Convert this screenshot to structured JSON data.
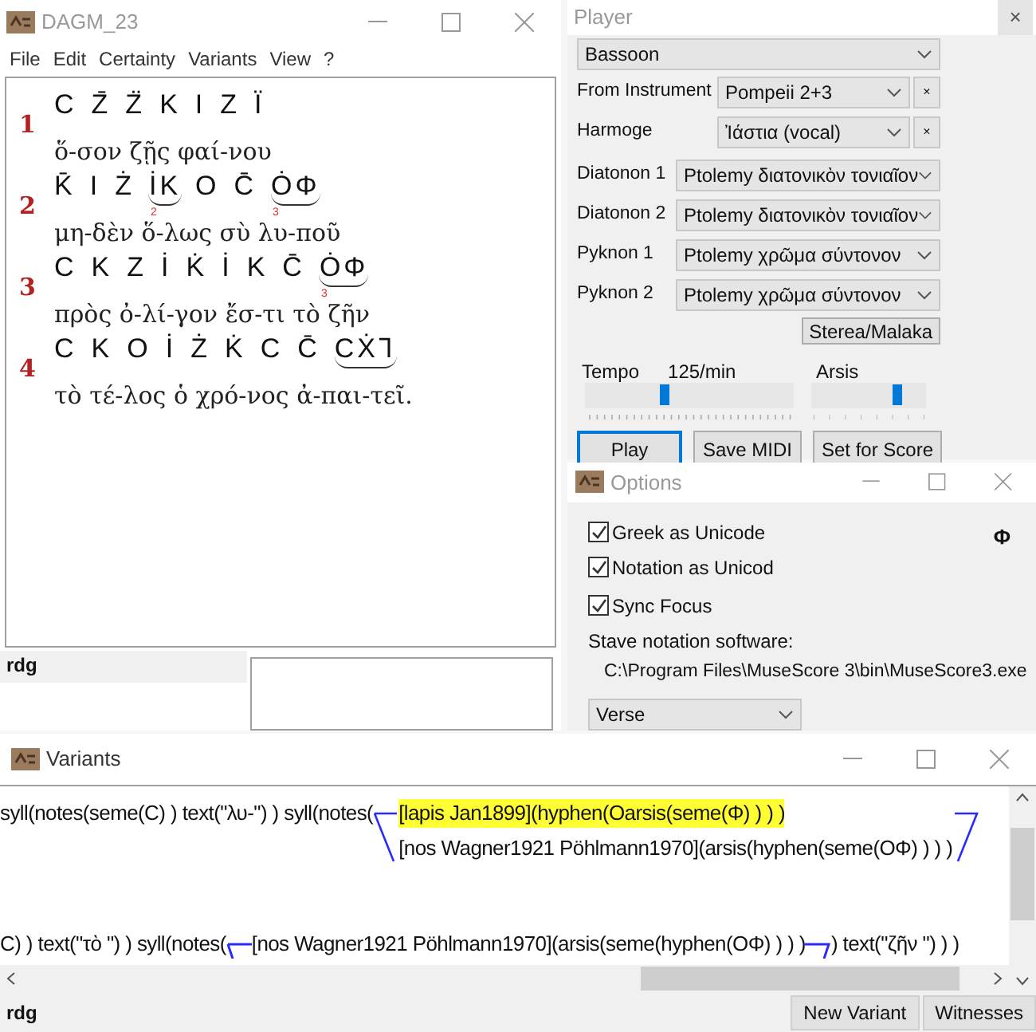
{
  "main_window": {
    "title": "DAGM_23",
    "menu": [
      "File",
      "Edit",
      "Certainty",
      "Variants",
      "View",
      "?"
    ],
    "lines": [
      {
        "number": "1",
        "notation": [
          {
            "text": "C",
            "slur": false
          },
          {
            "text": "Z̄",
            "slur": false
          },
          {
            "text": "Z̈",
            "slur": false
          },
          {
            "text": "K",
            "slur": false
          },
          {
            "text": "I",
            "slur": false
          },
          {
            "text": "Z",
            "slur": false
          },
          {
            "text": "Ï",
            "slur": false
          }
        ],
        "lyrics": "ὅ-σον ζῇς φαί-νου"
      },
      {
        "number": "2",
        "notation": [
          {
            "text": "K̄",
            "slur": false
          },
          {
            "text": "I",
            "slur": false
          },
          {
            "text": "Ż",
            "slur": false
          },
          {
            "text": "İK",
            "slur": true,
            "mark": "2"
          },
          {
            "text": "O",
            "slur": false
          },
          {
            "text": "C̄",
            "slur": false
          },
          {
            "text": "ȮΦ",
            "slur": true,
            "mark": "3"
          }
        ],
        "lyrics": "μη-δὲν ὅ-λως σὺ λυ-ποῦ"
      },
      {
        "number": "3",
        "notation": [
          {
            "text": "C",
            "slur": false
          },
          {
            "text": "K",
            "slur": false
          },
          {
            "text": "Z",
            "slur": false
          },
          {
            "text": "İ",
            "slur": false
          },
          {
            "text": "K̇",
            "slur": false
          },
          {
            "text": "İ",
            "slur": false
          },
          {
            "text": "K",
            "slur": false
          },
          {
            "text": "C̄",
            "slur": false
          },
          {
            "text": "ȮΦ",
            "slur": true,
            "mark": "3"
          }
        ],
        "lyrics": "πρὸς ὀ-λί-γον ἔσ-τι τὸ ζῆν"
      },
      {
        "number": "4",
        "notation": [
          {
            "text": "C",
            "slur": false
          },
          {
            "text": "K",
            "slur": false
          },
          {
            "text": "O",
            "slur": false
          },
          {
            "text": "İ",
            "slur": false
          },
          {
            "text": "Ż",
            "slur": false
          },
          {
            "text": "K̇",
            "slur": false
          },
          {
            "text": "C",
            "slur": false
          },
          {
            "text": "C̄",
            "slur": false
          },
          {
            "text": "CẊ⅂",
            "slur": true
          }
        ],
        "lyrics": "τὸ τέ-λος ὁ χρό-νος ἀ-παι-τεῖ."
      }
    ],
    "rdg_label": "rdg"
  },
  "player": {
    "title": "Player",
    "close": "×",
    "instrument": "Bassoon",
    "rows": [
      {
        "kind": "clearable",
        "label": "From Instrument",
        "value": "Pompeii 2+3",
        "clear": "×"
      },
      {
        "kind": "clearable",
        "label": "Harmoge",
        "value": "Ἰάστια (vocal)",
        "clear": "×"
      },
      {
        "kind": "plain",
        "label": "Diatonon 1",
        "value": "Ptolemy διατονικὸν τονιαῖον"
      },
      {
        "kind": "plain",
        "label": "Diatonon 2",
        "value": "Ptolemy διατονικὸν τονιαῖον"
      },
      {
        "kind": "plain",
        "label": "Pyknon 1",
        "value": "Ptolemy χρῶμα σύντονον"
      },
      {
        "kind": "plain",
        "label": "Pyknon 2",
        "value": "Ptolemy χρῶμα σύντονον"
      }
    ],
    "sterea_button": "Sterea/Malaka",
    "tempo": {
      "label": "Tempo",
      "reading": "125/min",
      "level": 0.38
    },
    "arsis": {
      "label": "Arsis",
      "level": 0.75
    },
    "buttons": [
      {
        "label": "Play",
        "focused": true
      },
      {
        "label": "Save MIDI",
        "focused": false
      },
      {
        "label": "Set for Score",
        "focused": false
      }
    ]
  },
  "options": {
    "title": "Options",
    "symbol": "Φ",
    "checkboxes": [
      {
        "label": "Greek as Unicode",
        "checked": true
      },
      {
        "label": "Notation as Unicod",
        "checked": true
      },
      {
        "label": "Sync Focus",
        "checked": true
      }
    ],
    "software_label": "Stave notation software:",
    "software_path": "C:\\Program Files\\MuseScore 3\\bin\\MuseScore3.exe",
    "mode": "Verse"
  },
  "variants": {
    "title": "Variants",
    "blocks": [
      {
        "prefix": "syll(notes(seme(C) ) text(\"λυ-\") ) syll(notes(",
        "options": [
          {
            "text": "[lapis Jan1899](hyphen(Oarsis(seme(Φ) ) ) )",
            "selected": true
          },
          {
            "text": "[nos Wagner1921 Pöhlmann1970](arsis(hyphen(seme(OΦ) ) ) )",
            "selected": false
          }
        ]
      },
      {
        "prefix": "C) ) text(\"τὸ \") ) syll(notes(",
        "options": [
          {
            "text": "[nos Wagner1921 Pöhlmann1970](arsis(seme(hyphen(OΦ) ) ) )",
            "selected": false
          }
        ],
        "suffix": ") text(\"ζῆν \") ) )"
      }
    ],
    "rdg_label": "rdg",
    "buttons": [
      "New Variant",
      "Witnesses"
    ]
  }
}
